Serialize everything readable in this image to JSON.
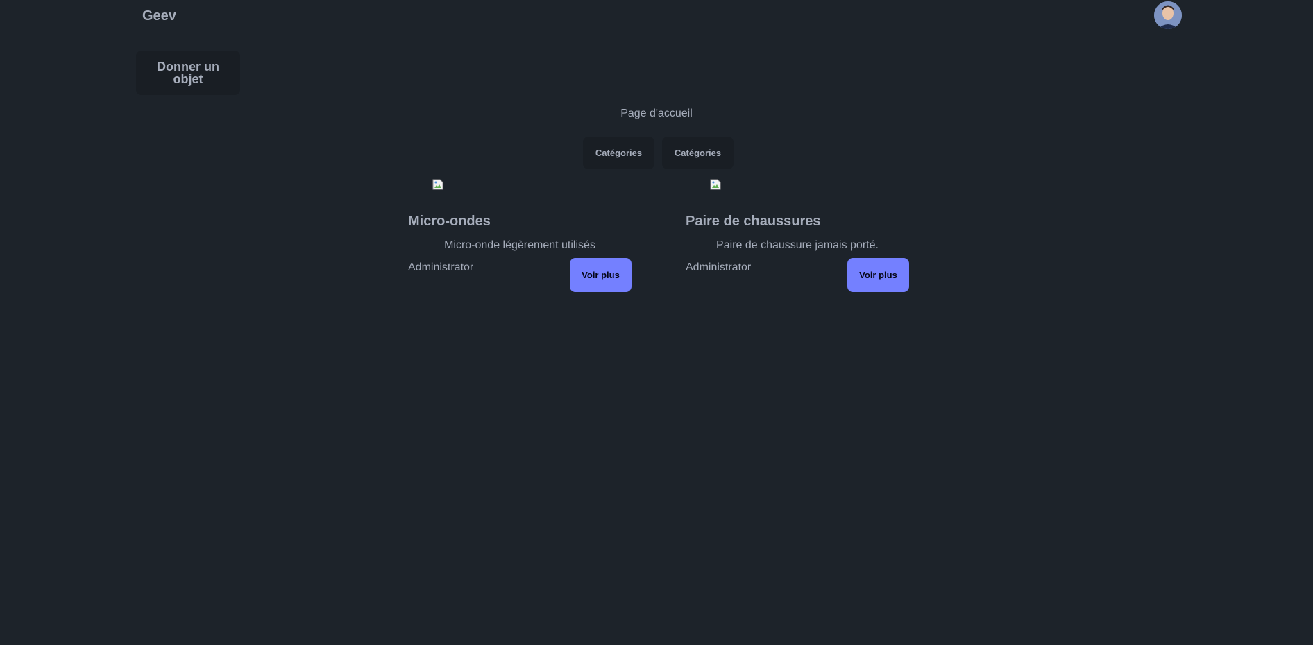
{
  "navbar": {
    "brand": "Geev",
    "avatar_icon": "user-avatar-icon"
  },
  "sidebar": {
    "give_button_label": "Donner un objet"
  },
  "main": {
    "title": "Page d'accueil",
    "category_buttons": [
      "Catégories",
      "Catégories"
    ],
    "items": [
      {
        "title": "Micro-ondes",
        "description": "Micro-onde légèrement utilisés",
        "owner": "Administrator",
        "button_label": "Voir plus",
        "image_icon": "broken-image-icon"
      },
      {
        "title": "Paire de chaussures",
        "description": "Paire de chaussure jamais porté.",
        "owner": "Administrator",
        "button_label": "Voir plus",
        "image_icon": "broken-image-icon"
      }
    ]
  },
  "colors": {
    "background": "#1d232a",
    "surface": "#191e24",
    "text": "#a6adbb",
    "primary": "#7480ff"
  }
}
